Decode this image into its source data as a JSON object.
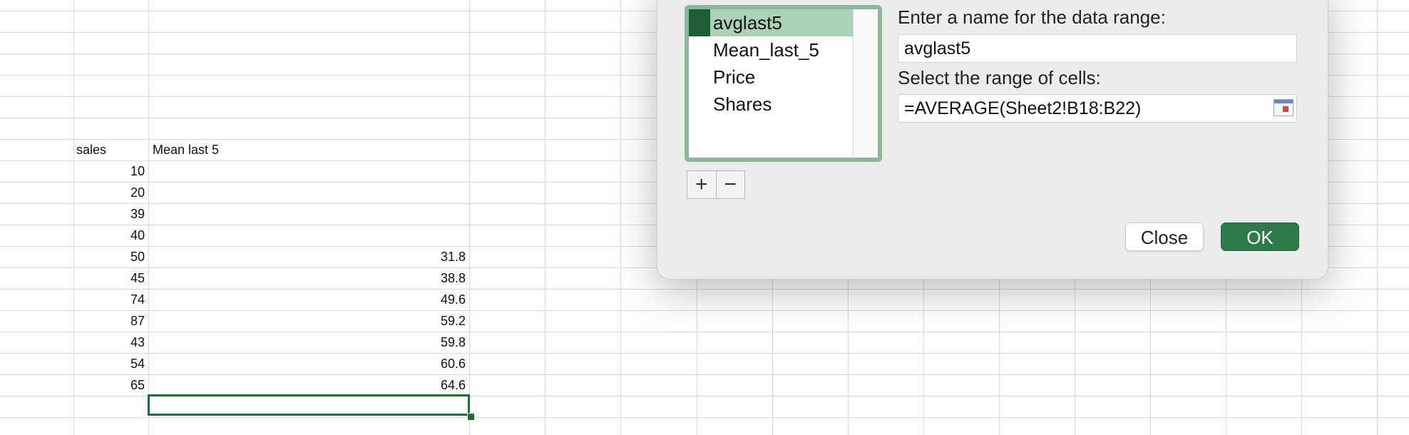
{
  "sheet": {
    "headers": {
      "col_b": "sales",
      "col_c": "Mean last 5"
    },
    "rows": [
      {
        "sales": "10",
        "mean": ""
      },
      {
        "sales": "20",
        "mean": ""
      },
      {
        "sales": "39",
        "mean": ""
      },
      {
        "sales": "40",
        "mean": ""
      },
      {
        "sales": "50",
        "mean": "31.8"
      },
      {
        "sales": "45",
        "mean": "38.8"
      },
      {
        "sales": "74",
        "mean": "49.6"
      },
      {
        "sales": "87",
        "mean": "59.2"
      },
      {
        "sales": "43",
        "mean": "59.8"
      },
      {
        "sales": "54",
        "mean": "60.6"
      },
      {
        "sales": "65",
        "mean": "64.6"
      }
    ]
  },
  "dialog": {
    "names": [
      "avglast5",
      "Mean_last_5",
      "Price",
      "Shares"
    ],
    "selected_index": 0,
    "add_label": "+",
    "remove_label": "−",
    "name_prompt": "Enter a name for the data range:",
    "name_value": "avglast5",
    "range_prompt": "Select the range of cells:",
    "range_value": "=AVERAGE(Sheet2!B18:B22)",
    "close_label": "Close",
    "ok_label": "OK"
  },
  "colors": {
    "accent": "#2f7a4a",
    "selection": "#acd2b5",
    "list_border": "#8db79a",
    "grid": "#d9d9d9"
  }
}
